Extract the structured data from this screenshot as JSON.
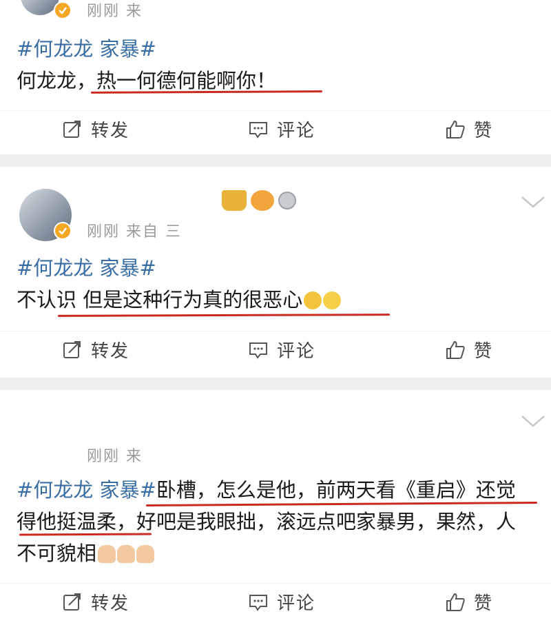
{
  "posts": [
    {
      "meta": "刚刚 来",
      "topic": "#何龙龙 家暴#",
      "text_plain": "何龙龙，",
      "text_underlined": "热一何德何能啊你！",
      "repost_label": "转发",
      "comment_label": "评论",
      "like_label": "赞"
    },
    {
      "meta": "刚刚 来自 三",
      "topic": "#何龙龙 家暴#",
      "text_plain": "不认识 ",
      "text_underlined": "但是这种行为真的很恶心",
      "emojis": [
        "crying-emoji",
        "thinking-emoji"
      ],
      "repost_label": "转发",
      "comment_label": "评论",
      "like_label": "赞"
    },
    {
      "meta": "刚刚 来",
      "topic": "#何龙龙 家暴#",
      "line1_rest": "卧槽，怎么是他，前两天看《重启》还觉",
      "line2": "得他挺温柔，好吧是我眼拙，滚远点吧家暴男，果然，人",
      "line3": "不可貌相",
      "emojis": [
        "pray-emoji",
        "pray-emoji",
        "pray-emoji"
      ],
      "repost_label": "转发",
      "comment_label": "评论",
      "like_label": "赞"
    }
  ],
  "colors": {
    "topic": "#3a6ea5",
    "underline": "#cc2a20",
    "verified": "#f4a825",
    "separator": "#efefef"
  }
}
